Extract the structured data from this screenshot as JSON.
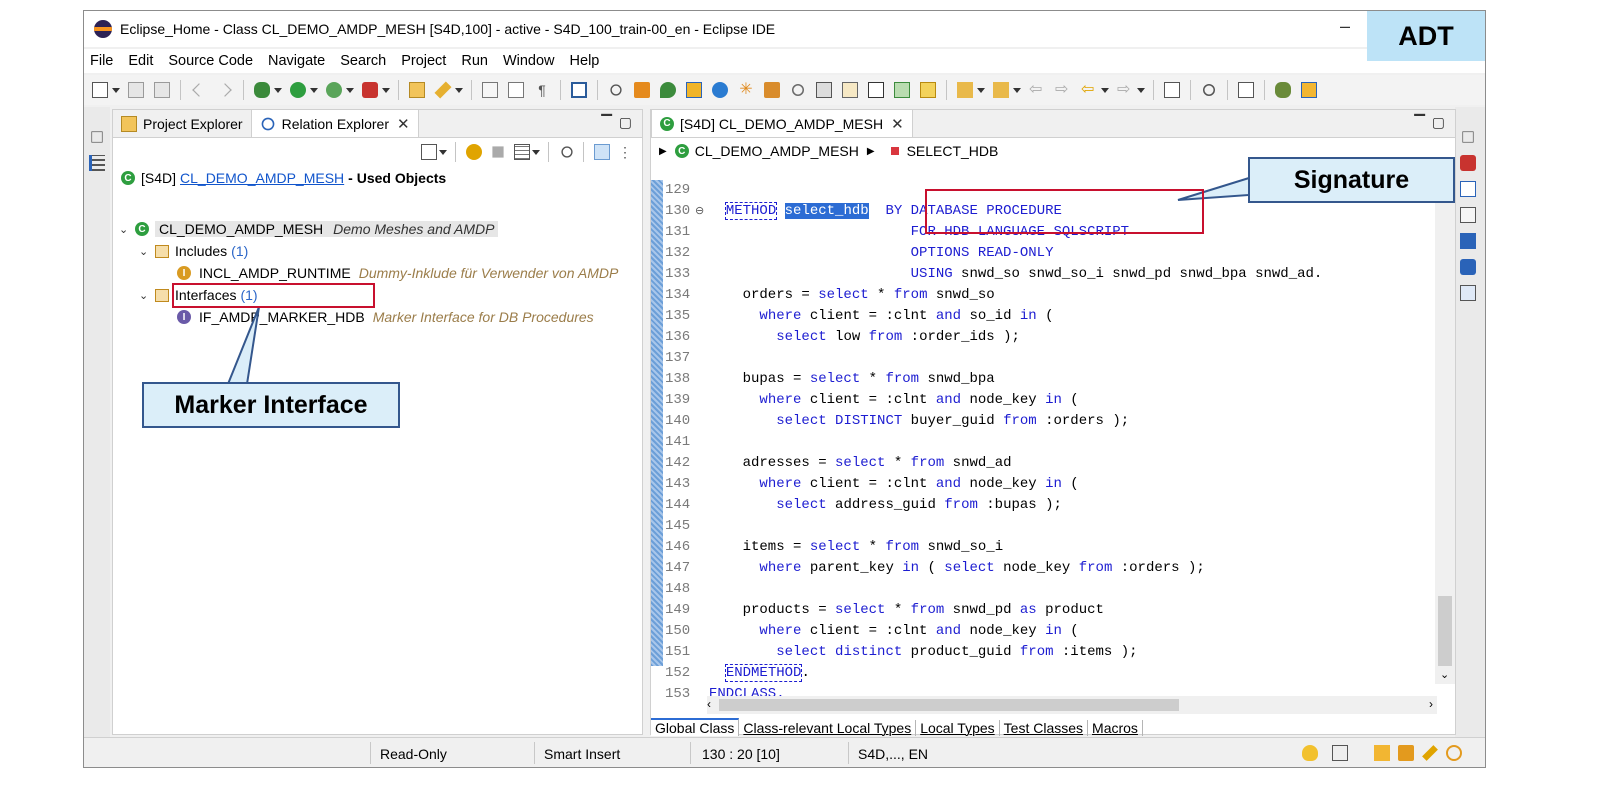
{
  "window": {
    "title": "Eclipse_Home - Class CL_DEMO_AMDP_MESH [S4D,100] - active - S4D_100_train-00_en - Eclipse IDE",
    "minimize": "–"
  },
  "badge": "ADT",
  "menu": [
    "File",
    "Edit",
    "Source Code",
    "Navigate",
    "Search",
    "Project",
    "Run",
    "Window",
    "Help"
  ],
  "left_panel": {
    "tabs": [
      {
        "label": "Project Explorer",
        "icon": "project-explorer-icon"
      },
      {
        "label": "Relation Explorer",
        "icon": "relation-explorer-icon"
      }
    ],
    "header": {
      "system": "[S4D]",
      "object": "CL_DEMO_AMDP_MESH",
      "suffix": "- Used Objects"
    },
    "tree": {
      "root": {
        "name": "CL_DEMO_AMDP_MESH",
        "description": "Demo Meshes and AMDP"
      },
      "includes": {
        "label": "Includes",
        "count": "(1)"
      },
      "include_item": {
        "name": "INCL_AMDP_RUNTIME",
        "description": "Dummy-Inklude für Verwender von AMDP"
      },
      "interfaces": {
        "label": "Interfaces",
        "count": "(1)"
      },
      "interface_item": {
        "name": "IF_AMDP_MARKER_HDB",
        "description": "Marker Interface for DB Procedures"
      }
    }
  },
  "editor": {
    "tab": "[S4D] CL_DEMO_AMDP_MESH",
    "breadcrumb": {
      "class": "CL_DEMO_AMDP_MESH",
      "method": "SELECT_HDB"
    },
    "lines": [
      {
        "n": "129",
        "parts": [
          {
            "t": ""
          }
        ]
      },
      {
        "n": "130",
        "parts": [
          {
            "t": "  "
          },
          {
            "t": "METHOD",
            "c": "kw boxed"
          },
          {
            "t": " "
          },
          {
            "t": "select_hdb",
            "c": "sel"
          },
          {
            "t": "  "
          },
          {
            "t": "BY DATABASE PROCEDURE",
            "c": "kw"
          }
        ]
      },
      {
        "n": "131",
        "parts": [
          {
            "t": "                        "
          },
          {
            "t": "FOR HDB LANGUAGE SQLSCRIPT",
            "c": "kw"
          }
        ]
      },
      {
        "n": "132",
        "parts": [
          {
            "t": "                        "
          },
          {
            "t": "OPTIONS READ-ONLY",
            "c": "kw"
          }
        ]
      },
      {
        "n": "133",
        "parts": [
          {
            "t": "                        "
          },
          {
            "t": "USING",
            "c": "kw"
          },
          {
            "t": " snwd_so snwd_so_i snwd_pd snwd_bpa snwd_ad."
          }
        ]
      },
      {
        "n": "134",
        "parts": [
          {
            "t": "    orders = "
          },
          {
            "t": "select",
            "c": "kw"
          },
          {
            "t": " * "
          },
          {
            "t": "from",
            "c": "kw"
          },
          {
            "t": " snwd_so"
          }
        ]
      },
      {
        "n": "135",
        "parts": [
          {
            "t": "      "
          },
          {
            "t": "where",
            "c": "kw"
          },
          {
            "t": " client = :clnt "
          },
          {
            "t": "and",
            "c": "kw"
          },
          {
            "t": " so_id "
          },
          {
            "t": "in",
            "c": "kw"
          },
          {
            "t": " ("
          }
        ]
      },
      {
        "n": "136",
        "parts": [
          {
            "t": "        "
          },
          {
            "t": "select",
            "c": "kw"
          },
          {
            "t": " low "
          },
          {
            "t": "from",
            "c": "kw"
          },
          {
            "t": " :order_ids );"
          }
        ]
      },
      {
        "n": "137",
        "parts": [
          {
            "t": ""
          }
        ]
      },
      {
        "n": "138",
        "parts": [
          {
            "t": "    bupas = "
          },
          {
            "t": "select",
            "c": "kw"
          },
          {
            "t": " * "
          },
          {
            "t": "from",
            "c": "kw"
          },
          {
            "t": " snwd_bpa"
          }
        ]
      },
      {
        "n": "139",
        "parts": [
          {
            "t": "      "
          },
          {
            "t": "where",
            "c": "kw"
          },
          {
            "t": " client = :clnt "
          },
          {
            "t": "and",
            "c": "kw"
          },
          {
            "t": " node_key "
          },
          {
            "t": "in",
            "c": "kw"
          },
          {
            "t": " ("
          }
        ]
      },
      {
        "n": "140",
        "parts": [
          {
            "t": "        "
          },
          {
            "t": "select",
            "c": "kw"
          },
          {
            "t": " "
          },
          {
            "t": "DISTINCT",
            "c": "kw"
          },
          {
            "t": " buyer_guid "
          },
          {
            "t": "from",
            "c": "kw"
          },
          {
            "t": " :orders );"
          }
        ]
      },
      {
        "n": "141",
        "parts": [
          {
            "t": ""
          }
        ]
      },
      {
        "n": "142",
        "parts": [
          {
            "t": "    adresses = "
          },
          {
            "t": "select",
            "c": "kw"
          },
          {
            "t": " * "
          },
          {
            "t": "from",
            "c": "kw"
          },
          {
            "t": " snwd_ad"
          }
        ]
      },
      {
        "n": "143",
        "parts": [
          {
            "t": "      "
          },
          {
            "t": "where",
            "c": "kw"
          },
          {
            "t": " client = :clnt "
          },
          {
            "t": "and",
            "c": "kw"
          },
          {
            "t": " node_key "
          },
          {
            "t": "in",
            "c": "kw"
          },
          {
            "t": " ("
          }
        ]
      },
      {
        "n": "144",
        "parts": [
          {
            "t": "        "
          },
          {
            "t": "select",
            "c": "kw"
          },
          {
            "t": " address_guid "
          },
          {
            "t": "from",
            "c": "kw"
          },
          {
            "t": " :bupas );"
          }
        ]
      },
      {
        "n": "145",
        "parts": [
          {
            "t": ""
          }
        ]
      },
      {
        "n": "146",
        "parts": [
          {
            "t": "    items = "
          },
          {
            "t": "select",
            "c": "kw"
          },
          {
            "t": " * "
          },
          {
            "t": "from",
            "c": "kw"
          },
          {
            "t": " snwd_so_i"
          }
        ]
      },
      {
        "n": "147",
        "parts": [
          {
            "t": "      "
          },
          {
            "t": "where",
            "c": "kw"
          },
          {
            "t": " parent_key "
          },
          {
            "t": "in",
            "c": "kw"
          },
          {
            "t": " ( "
          },
          {
            "t": "select",
            "c": "kw"
          },
          {
            "t": " node_key "
          },
          {
            "t": "from",
            "c": "kw"
          },
          {
            "t": " :orders );"
          }
        ]
      },
      {
        "n": "148",
        "parts": [
          {
            "t": ""
          }
        ]
      },
      {
        "n": "149",
        "parts": [
          {
            "t": "    products = "
          },
          {
            "t": "select",
            "c": "kw"
          },
          {
            "t": " * "
          },
          {
            "t": "from",
            "c": "kw"
          },
          {
            "t": " snwd_pd "
          },
          {
            "t": "as",
            "c": "kw"
          },
          {
            "t": " product"
          }
        ]
      },
      {
        "n": "150",
        "parts": [
          {
            "t": "      "
          },
          {
            "t": "where",
            "c": "kw"
          },
          {
            "t": " client = :clnt "
          },
          {
            "t": "and",
            "c": "kw"
          },
          {
            "t": " node_key "
          },
          {
            "t": "in",
            "c": "kw"
          },
          {
            "t": " ("
          }
        ]
      },
      {
        "n": "151",
        "parts": [
          {
            "t": "        "
          },
          {
            "t": "select",
            "c": "kw"
          },
          {
            "t": " "
          },
          {
            "t": "distinct",
            "c": "kw"
          },
          {
            "t": " product_guid "
          },
          {
            "t": "from",
            "c": "kw"
          },
          {
            "t": " :items );"
          }
        ]
      },
      {
        "n": "152",
        "parts": [
          {
            "t": "  "
          },
          {
            "t": "ENDMETHOD",
            "c": "kw boxed"
          },
          {
            "t": "."
          }
        ]
      },
      {
        "n": "153",
        "parts": [
          {
            "t": "ENDCLASS.",
            "c": "kw"
          }
        ]
      }
    ],
    "bottom_tabs": [
      "Global Class",
      "Class-relevant Local Types",
      "Local Types",
      "Test Classes",
      "Macros"
    ]
  },
  "status": {
    "mode": "Read-Only",
    "insert": "Smart Insert",
    "position": "130 : 20 [10]",
    "system": "S4D,..., EN"
  },
  "callouts": {
    "signature": "Signature",
    "marker_interface": "Marker Interface"
  },
  "colors": {
    "keyword": "#1d1dd1",
    "callout_fill": "#dbeef9",
    "callout_border": "#34578d",
    "highlight_box": "#c8102e",
    "badge": "#bde3f7"
  }
}
